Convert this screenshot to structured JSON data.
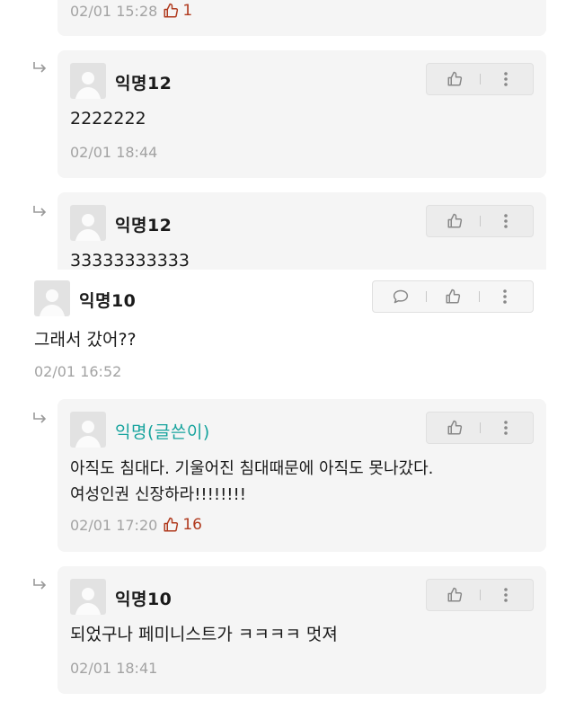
{
  "comments": [
    {
      "kind": "reply",
      "name": "",
      "text": "",
      "time": "02/01 15:28",
      "likes": "1"
    },
    {
      "kind": "reply",
      "name": "익명12",
      "text": "2222222",
      "time": "02/01 18:44",
      "likes": ""
    },
    {
      "kind": "reply",
      "name": "익명12",
      "text": "33333333333",
      "time": "",
      "likes": ""
    },
    {
      "kind": "comment",
      "name": "익명10",
      "text": "그래서 갔어??",
      "time": "02/01 16:52",
      "likes": ""
    },
    {
      "kind": "reply",
      "name": "익명(글쓴이)",
      "text_lines": [
        "아직도 침대다. 기울어진 침대때문에 아직도 못나갔다.",
        "여성인권 신장하라!!!!!!!!"
      ],
      "time": "02/01 17:20",
      "likes": "16"
    },
    {
      "kind": "reply",
      "name": "익명10",
      "text": "되었구나 페미니스트가 ㅋㅋㅋㅋ 멋져",
      "time": "02/01 18:41",
      "likes": ""
    }
  ],
  "colors": {
    "writer_name": "#16a39d",
    "like_count": "#b03a1e",
    "timestamp": "#a3a3a3",
    "reply_bg": "#f5f5f5"
  },
  "icons": [
    "reply-arrow-icon",
    "avatar-icon",
    "thumbs-up-icon",
    "more-vertical-icon",
    "speech-bubble-icon"
  ]
}
